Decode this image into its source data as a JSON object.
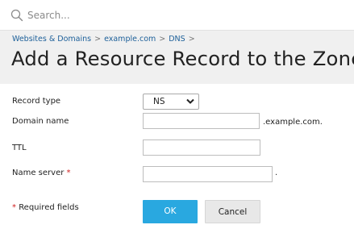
{
  "search": {
    "placeholder": "Search..."
  },
  "breadcrumb": [
    {
      "label": "Websites & Domains"
    },
    {
      "label": "example.com"
    },
    {
      "label": "DNS"
    }
  ],
  "breadcrumb_separator": ">",
  "page_title": "Add a Resource Record to the Zone",
  "form": {
    "record_type": {
      "label": "Record type",
      "value": "NS"
    },
    "domain_name": {
      "label": "Domain name",
      "value": "",
      "suffix": ".example.com."
    },
    "ttl": {
      "label": "TTL",
      "value": ""
    },
    "name_server": {
      "label": "Name server",
      "required_mark": "*",
      "value": "",
      "suffix": "."
    }
  },
  "required_note": {
    "mark": "*",
    "text": "Required fields"
  },
  "buttons": {
    "ok": "OK",
    "cancel": "Cancel"
  },
  "colors": {
    "accent": "#29a8e0",
    "link": "#1c5f99",
    "required": "#d02020",
    "header_bg": "#f0f0f0"
  },
  "icons": {
    "search": "search-icon",
    "select": "chevron-down-icon"
  }
}
